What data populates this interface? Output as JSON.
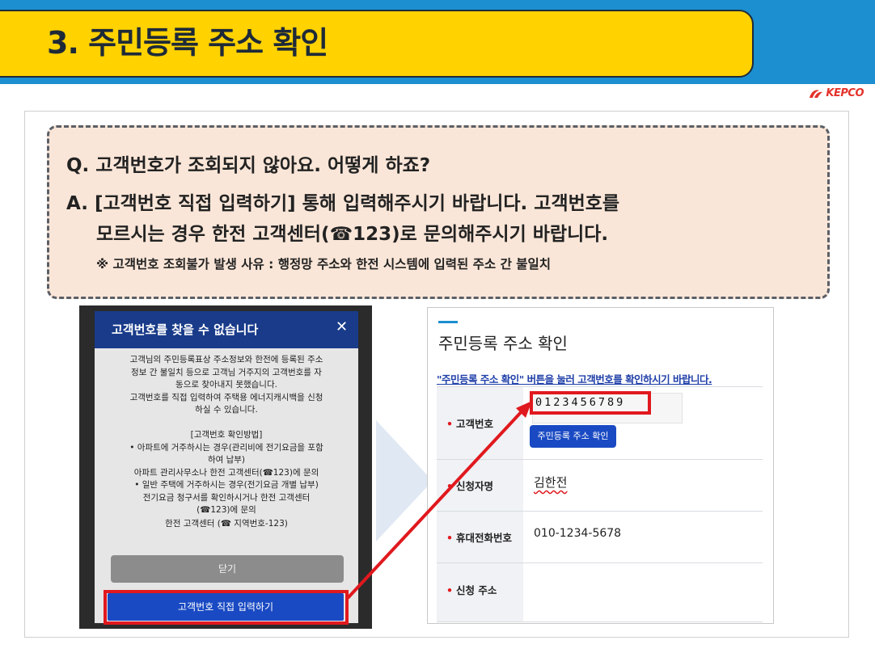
{
  "header": {
    "title": "3. 주민등록 주소 확인"
  },
  "brand": {
    "logo_text": "KEPCO"
  },
  "qa": {
    "question": "Q. 고객번호가 조회되지 않아요. 어떻게 하죠?",
    "answer_line1": "A. [고객번호 직접 입력하기] 통해 입력해주시기 바랍니다. 고객번호를",
    "answer_line2": "모르시는 경우 한전 고객센터(☎123)로 문의해주시기 바랍니다.",
    "note": "※ 고객번호 조회불가 발생 사유 : 행정망 주소와 한전 시스템에 입력된 주소 간 불일치"
  },
  "dialog": {
    "title": "고객번호를 찾을 수 없습니다",
    "close_symbol": "✕",
    "p1": [
      "고객님의 주민등록표상 주소정보와 한전에 등록된 주소",
      "정보 간 불일치 등으로 고객님 거주지의 고객번호를 자",
      "동으로 찾아내지 못했습니다.",
      "고객번호를 직접 입력하여 주택용 에너지캐시백을 신청",
      "하실 수 있습니다."
    ],
    "p2": [
      "[고객번호 확인방법]",
      "• 아파트에 거주하시는 경우(관리비에 전기요금을 포함",
      "하여 납부)",
      "아파트 관리사무소나 한전 고객센터(☎123)에 문의",
      "• 일반 주택에 거주하시는 경우(전기요금 개별 납부)",
      "전기요금 청구서를 확인하시거나 한전 고객센터",
      "(☎123)에 문의"
    ],
    "center_contact": "한전 고객센터 (☎ 지역번호-123)",
    "close_button": "닫기",
    "direct_button": "고객번호 직접 입력하기"
  },
  "form": {
    "title": "주민등록 주소 확인",
    "guide": "\"주민등록 주소 확인\" 버튼을 눌러 고객번호를 확인하시기 바랍니다.",
    "rows": [
      {
        "label": "고객번호",
        "value": "0123456789"
      },
      {
        "label": "신청자명",
        "value": "김한전"
      },
      {
        "label": "휴대전화번호",
        "value": "010-1234-5678"
      },
      {
        "label": "신청 주소",
        "value": ""
      }
    ],
    "confirm_button": "주민등록 주소 확인"
  },
  "colors": {
    "header_blue": "#1b8fcf",
    "title_yellow": "#ffd200",
    "qa_bg": "#fae6d8",
    "highlight_red": "#e0191e",
    "button_blue": "#1a4ac3",
    "dialog_header": "#193b8a"
  }
}
